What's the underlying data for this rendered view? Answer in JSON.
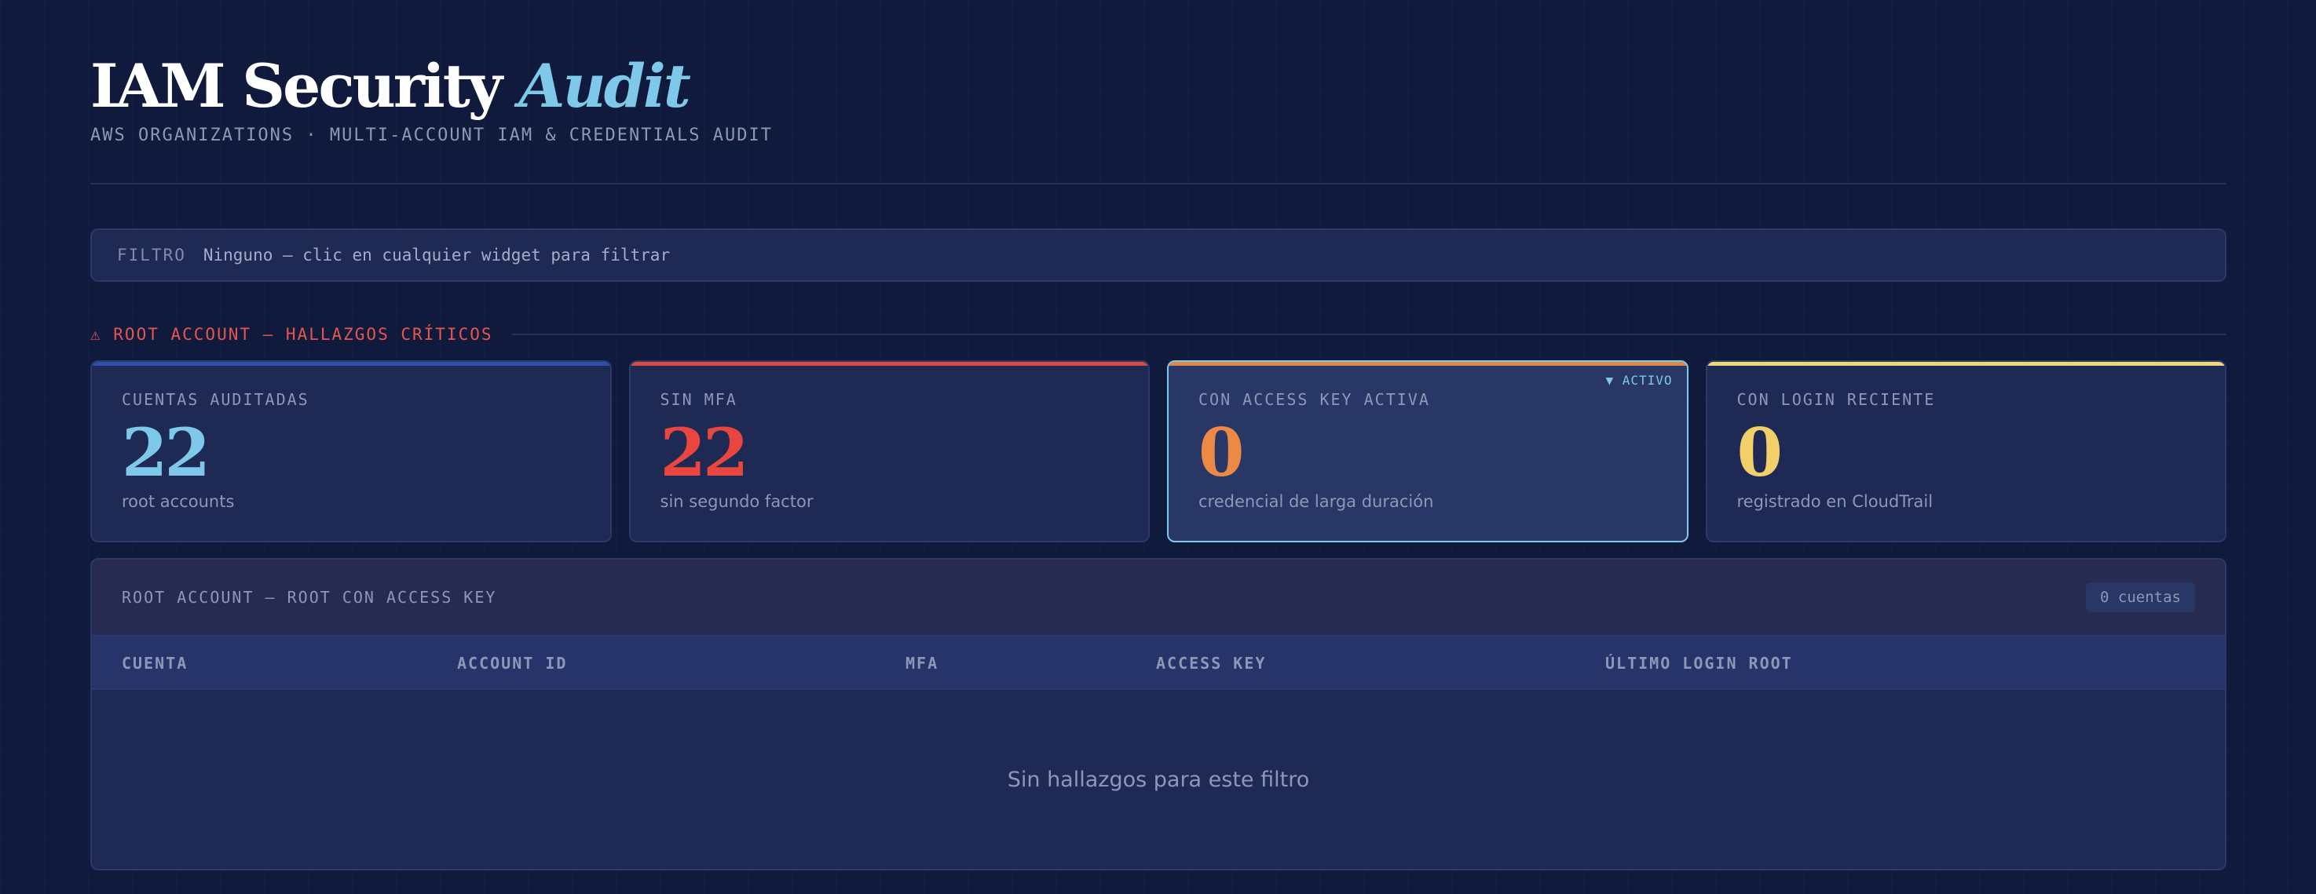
{
  "header": {
    "title_main": "IAM Security",
    "title_accent": "Audit",
    "subtitle": "AWS ORGANIZATIONS · MULTI-ACCOUNT IAM & CREDENTIALS AUDIT"
  },
  "filter": {
    "label": "FILTRO",
    "value": "Ninguno — clic en cualquier widget para filtrar"
  },
  "section": {
    "title": "⚠ ROOT ACCOUNT — HALLAZGOS CRÍTICOS"
  },
  "cards": [
    {
      "label": "CUENTAS AUDITADAS",
      "value": "22",
      "sub": "root accounts",
      "color": "#7ec8ea",
      "bar": "#2f4fb0"
    },
    {
      "label": "SIN MFA",
      "value": "22",
      "sub": "sin segundo factor",
      "color": "#e8463f",
      "bar": "#d94a47"
    },
    {
      "label": "CON ACCESS KEY ACTIVA",
      "value": "0",
      "sub": "credencial de larga duración",
      "color": "#ec8a45",
      "bar": "#e08a4a",
      "badge": "▼ ACTIVO"
    },
    {
      "label": "CON LOGIN RECIENTE",
      "value": "0",
      "sub": "registrado en CloudTrail",
      "color": "#f3cf6a",
      "bar": "#efd77a"
    }
  ],
  "panel": {
    "title": "ROOT ACCOUNT — ROOT CON ACCESS KEY",
    "count": "0 cuentas",
    "columns": [
      "CUENTA",
      "ACCOUNT ID",
      "MFA",
      "ACCESS KEY",
      "ÚLTIMO LOGIN ROOT"
    ],
    "empty": "Sin hallazgos para este filtro"
  },
  "colors": {
    "background": "#0f1a3d",
    "accent": "#7ec8ea",
    "critical": "#e8554f"
  }
}
